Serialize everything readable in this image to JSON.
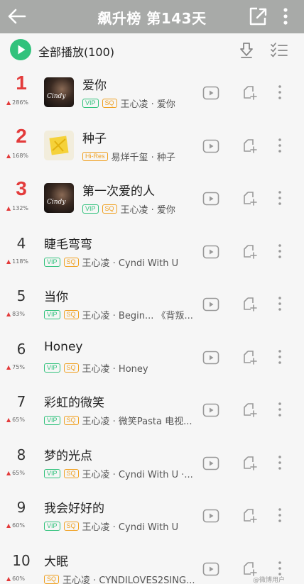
{
  "header": {
    "title": "飙升榜 第143天",
    "back_icon": "arrow-left-icon",
    "share_icon": "share-icon",
    "more_icon": "more-vertical-icon"
  },
  "playbar": {
    "play_all_label": "全部播放(100)",
    "download_icon": "download-icon",
    "multi_select_icon": "multi-select-icon",
    "accent": "#31c27c"
  },
  "colors": {
    "rank_top": "#e33b3b",
    "vip": "#31c27c",
    "sq": "#f0a020"
  },
  "songs": [
    {
      "rank": "1",
      "change": "286%",
      "title": "爱你",
      "tags": [
        "VIP",
        "SQ"
      ],
      "artist": "王心凌 · 爱你",
      "cover": "dark"
    },
    {
      "rank": "2",
      "change": "168%",
      "title": "种子",
      "tags": [
        "Hi-Res"
      ],
      "artist": "易烊千玺 · 种子",
      "cover": "yellow"
    },
    {
      "rank": "3",
      "change": "132%",
      "title": "第一次爱的人",
      "tags": [
        "VIP",
        "SQ"
      ],
      "artist": "王心凌 · 爱你",
      "cover": "dark"
    },
    {
      "rank": "4",
      "change": "118%",
      "title": "睫毛弯弯",
      "tags": [
        "VIP",
        "SQ"
      ],
      "artist": "王心凌 · Cyndi With U"
    },
    {
      "rank": "5",
      "change": "83%",
      "title": "当你",
      "tags": [
        "VIP",
        "SQ"
      ],
      "artist": "王心凌 · Begin... 《背叛..."
    },
    {
      "rank": "6",
      "change": "75%",
      "title": "Honey",
      "tags": [
        "VIP",
        "SQ"
      ],
      "artist": "王心凌 · Honey"
    },
    {
      "rank": "7",
      "change": "65%",
      "title": "彩虹的微笑",
      "tags": [
        "VIP",
        "SQ"
      ],
      "artist": "王心凌 · 微笑Pasta 电视..."
    },
    {
      "rank": "8",
      "change": "65%",
      "title": "梦的光点",
      "tags": [
        "VIP",
        "SQ"
      ],
      "artist": "王心凌 · Cyndi With U ·..."
    },
    {
      "rank": "9",
      "change": "60%",
      "title": "我会好好的",
      "tags": [
        "VIP",
        "SQ"
      ],
      "artist": "王心凌 · Cyndi With U"
    },
    {
      "rank": "10",
      "change": "60%",
      "title": "大眠",
      "tags": [
        "SQ"
      ],
      "artist": "王心凌 · CYNDILOVES2SING..."
    }
  ],
  "row_icons": {
    "mv": "mv-play-icon",
    "add": "add-to-playlist-icon",
    "more": "more-vertical-icon"
  },
  "watermark": "@微博用户"
}
